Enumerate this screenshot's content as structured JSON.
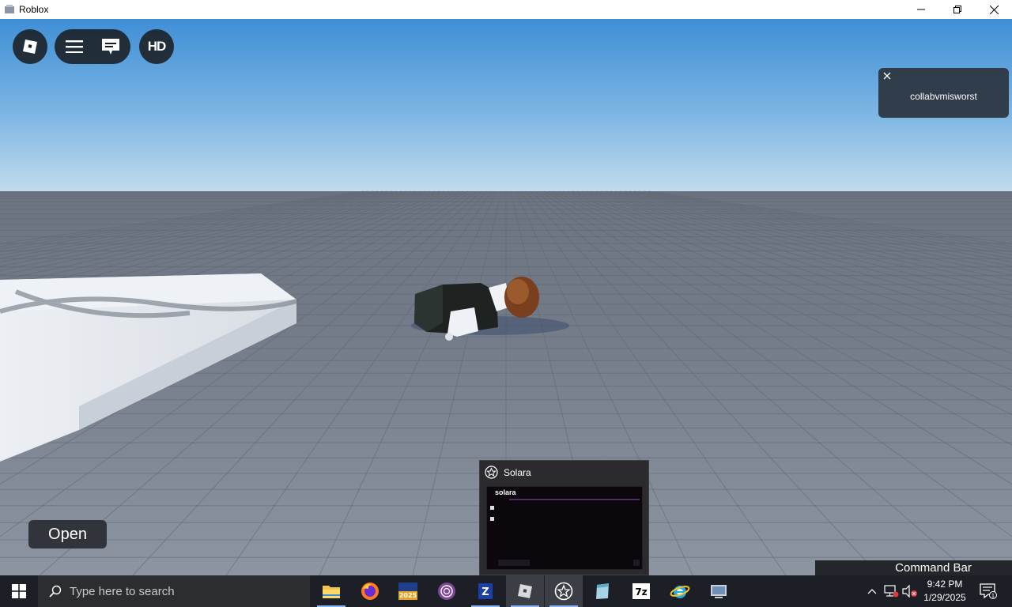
{
  "window": {
    "title": "Roblox"
  },
  "roblox_ui": {
    "hd_label": "HD",
    "open_label": "Open",
    "command_bar_label": "Command Bar"
  },
  "notification": {
    "message": "collabvmisworst"
  },
  "thumbnail": {
    "title": "Solara",
    "preview_title": "solara"
  },
  "taskbar": {
    "search_placeholder": "Type here to search",
    "apps": [
      "file-explorer",
      "firefox",
      "app-2025",
      "tor-browser",
      "app-blue",
      "roblox",
      "solara",
      "notepad-app",
      "7zip",
      "internet-explorer",
      "app-other"
    ],
    "clock_time": "9:42 PM",
    "clock_date": "1/29/2025",
    "notification_count": "1"
  },
  "colors": {
    "sky_top": "#3f8fd6",
    "sky_bottom": "#bcd9ec",
    "ground": "#7d8594",
    "taskbar": "#1c1f26"
  }
}
